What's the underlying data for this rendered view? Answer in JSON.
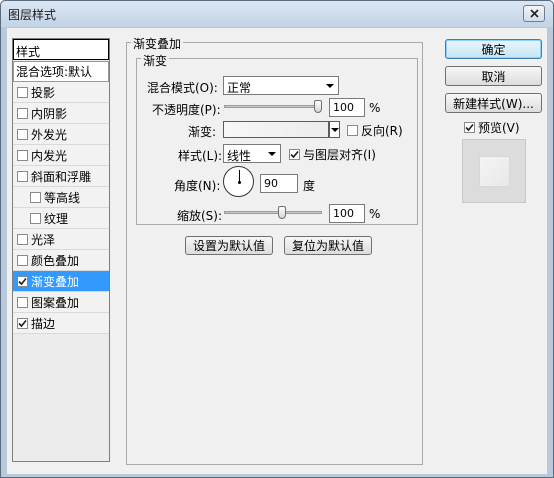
{
  "window": {
    "title": "图层样式"
  },
  "styles": {
    "header": "样式",
    "blend_options": "混合选项:默认",
    "items": [
      {
        "label": "投影",
        "checked": false,
        "sub": false,
        "selected": false
      },
      {
        "label": "内阴影",
        "checked": false,
        "sub": false,
        "selected": false
      },
      {
        "label": "外发光",
        "checked": false,
        "sub": false,
        "selected": false
      },
      {
        "label": "内发光",
        "checked": false,
        "sub": false,
        "selected": false
      },
      {
        "label": "斜面和浮雕",
        "checked": false,
        "sub": false,
        "selected": false
      },
      {
        "label": "等高线",
        "checked": false,
        "sub": true,
        "selected": false
      },
      {
        "label": "纹理",
        "checked": false,
        "sub": true,
        "selected": false
      },
      {
        "label": "光泽",
        "checked": false,
        "sub": false,
        "selected": false
      },
      {
        "label": "颜色叠加",
        "checked": false,
        "sub": false,
        "selected": false
      },
      {
        "label": "渐变叠加",
        "checked": true,
        "sub": false,
        "selected": true
      },
      {
        "label": "图案叠加",
        "checked": false,
        "sub": false,
        "selected": false
      },
      {
        "label": "描边",
        "checked": true,
        "sub": false,
        "selected": false
      }
    ]
  },
  "panel": {
    "group_title": "渐变叠加",
    "sub_title": "渐变",
    "blend_mode_label": "混合模式(O):",
    "blend_mode_value": "正常",
    "opacity_label": "不透明度(P):",
    "opacity_value": "100",
    "opacity_fraction": 1.0,
    "percent": "%",
    "gradient_label": "渐变:",
    "reverse_label": "反向(R)",
    "reverse_checked": false,
    "style_label": "样式(L):",
    "style_value": "线性",
    "align_label": "与图层对齐(I)",
    "align_checked": true,
    "angle_label": "角度(N):",
    "angle_value": "90",
    "angle_unit": "度",
    "scale_label": "缩放(S):",
    "scale_value": "100",
    "scale_fraction": 0.6,
    "make_default": "设置为默认值",
    "reset_default": "复位为默认值"
  },
  "actions": {
    "ok": "确定",
    "cancel": "取消",
    "new_style": "新建样式(W)...",
    "preview_label": "预览(V)",
    "preview_checked": true
  },
  "colors": {
    "selection": "#3399ff",
    "titlebar": "#c2d3e6"
  }
}
